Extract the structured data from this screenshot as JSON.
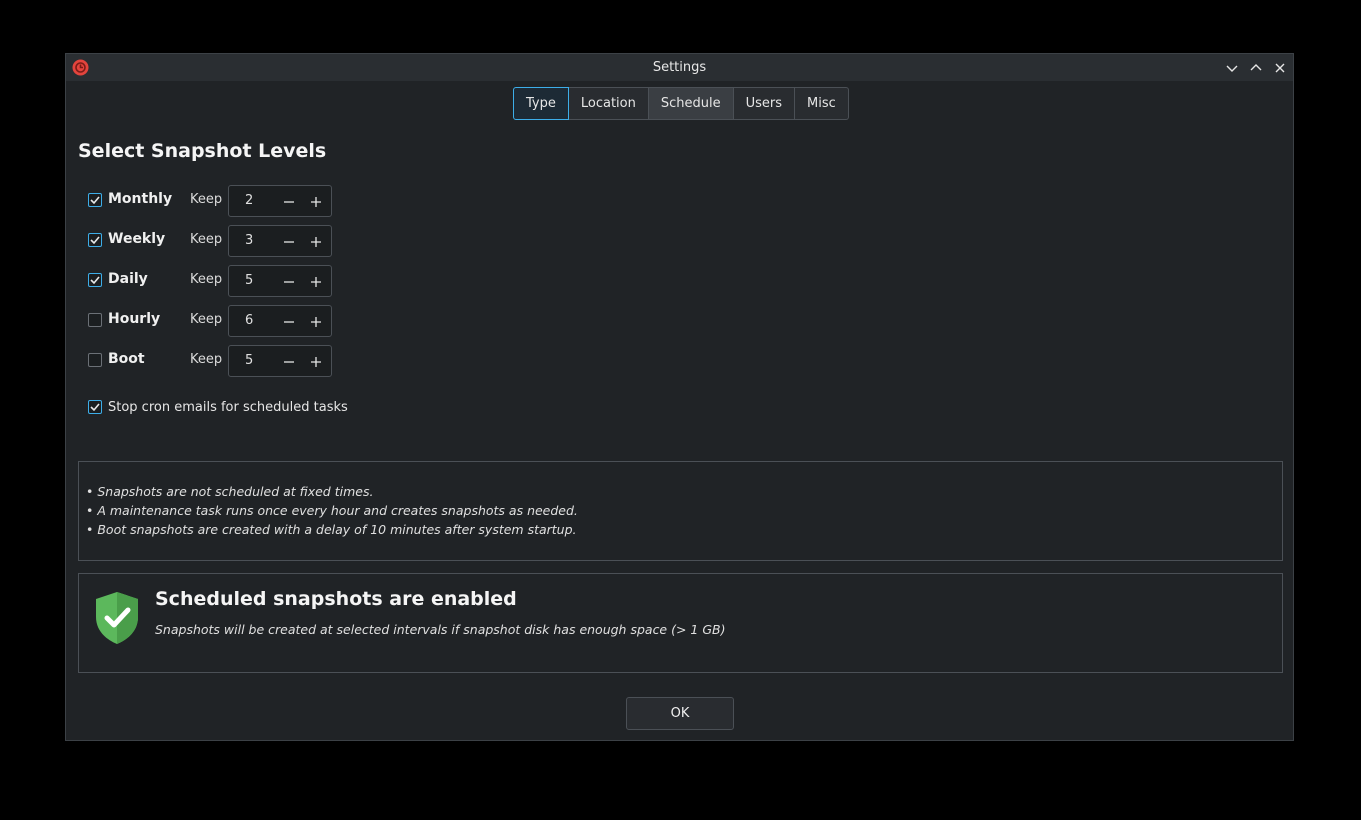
{
  "window": {
    "title": "Settings",
    "app_icon": "timeshift-icon",
    "controls": [
      "minimize-icon",
      "maximize-icon",
      "close-icon"
    ]
  },
  "tabs": [
    {
      "label": "Type",
      "active": true
    },
    {
      "label": "Location",
      "active": false
    },
    {
      "label": "Schedule",
      "active": false
    },
    {
      "label": "Users",
      "active": false
    },
    {
      "label": "Misc",
      "active": false
    }
  ],
  "heading": "Select Snapshot Levels",
  "levels": [
    {
      "label": "Monthly",
      "checked": true,
      "keep_label": "Keep",
      "value": "2"
    },
    {
      "label": "Weekly",
      "checked": true,
      "keep_label": "Keep",
      "value": "3"
    },
    {
      "label": "Daily",
      "checked": true,
      "keep_label": "Keep",
      "value": "5"
    },
    {
      "label": "Hourly",
      "checked": false,
      "keep_label": "Keep",
      "value": "6"
    },
    {
      "label": "Boot",
      "checked": false,
      "keep_label": "Keep",
      "value": "5"
    }
  ],
  "cron": {
    "label": "Stop cron emails for scheduled tasks",
    "checked": true
  },
  "notes": [
    "• Snapshots are not scheduled at fixed times.",
    "• A maintenance task runs once every hour and creates snapshots as needed.",
    "• Boot snapshots are created with a delay of 10 minutes after system startup."
  ],
  "status": {
    "icon": "shield-check-icon",
    "title": "Scheduled snapshots are enabled",
    "subtitle": "Snapshots will be created at selected intervals if snapshot disk has enough space (> 1 GB)"
  },
  "ok_label": "OK",
  "colors": {
    "accent": "#3daee9",
    "shield": "#5cb85c",
    "app_icon": "#e3443d"
  }
}
